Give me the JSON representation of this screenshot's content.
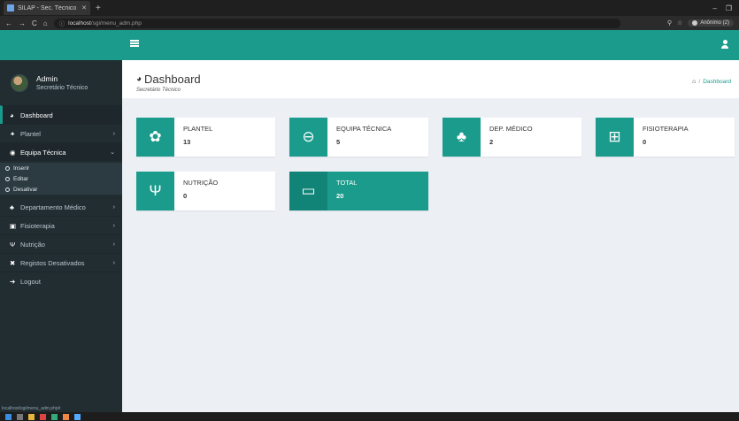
{
  "browser": {
    "tab_title": "SILAP - Sec. Técnico",
    "url_host": "localhost",
    "url_path": "/sgi/menu_adm.php",
    "profile": "Anônimo (2)"
  },
  "user": {
    "name": "Admin",
    "role": "Secretário Técnico"
  },
  "sidebar": {
    "items": [
      {
        "icon": "◕",
        "label": "Dashboard",
        "arrow": ""
      },
      {
        "icon": "✦",
        "label": "Plantel",
        "arrow": "›"
      },
      {
        "icon": "◉",
        "label": "Equipa Técnica",
        "arrow": "⌄"
      },
      {
        "icon": "♣",
        "label": "Departamento Médico",
        "arrow": "›"
      },
      {
        "icon": "▣",
        "label": "Fisioterapia",
        "arrow": "›"
      },
      {
        "icon": "Ψ",
        "label": "Nutrição",
        "arrow": "›"
      },
      {
        "icon": "✖",
        "label": "Registos Desativados",
        "arrow": "›"
      },
      {
        "icon": "➔",
        "label": "Logout",
        "arrow": ""
      }
    ],
    "submenu": [
      {
        "label": "Inserir"
      },
      {
        "label": "Editar"
      },
      {
        "label": "Desativar"
      }
    ],
    "status_url": "localhost/sgi/menu_adm.php#"
  },
  "header": {
    "title": "Dashboard",
    "subtitle": "Secretário Técnico",
    "breadcrumb": "Dashboard"
  },
  "boxes": [
    {
      "label": "PLANTEL",
      "value": "13",
      "icon": "✿"
    },
    {
      "label": "EQUIPA TÉCNICA",
      "value": "5",
      "icon": "⊖"
    },
    {
      "label": "DEP. MÉDICO",
      "value": "2",
      "icon": "♣"
    },
    {
      "label": "FISIOTERAPIA",
      "value": "0",
      "icon": "⊞"
    },
    {
      "label": "NUTRIÇÃO",
      "value": "0",
      "icon": "Ψ"
    },
    {
      "label": "TOTAL",
      "value": "20",
      "icon": "▭"
    }
  ],
  "colors": {
    "accent": "#1a9b8c",
    "sidebar": "#222d32",
    "background": "#ecf0f5"
  }
}
